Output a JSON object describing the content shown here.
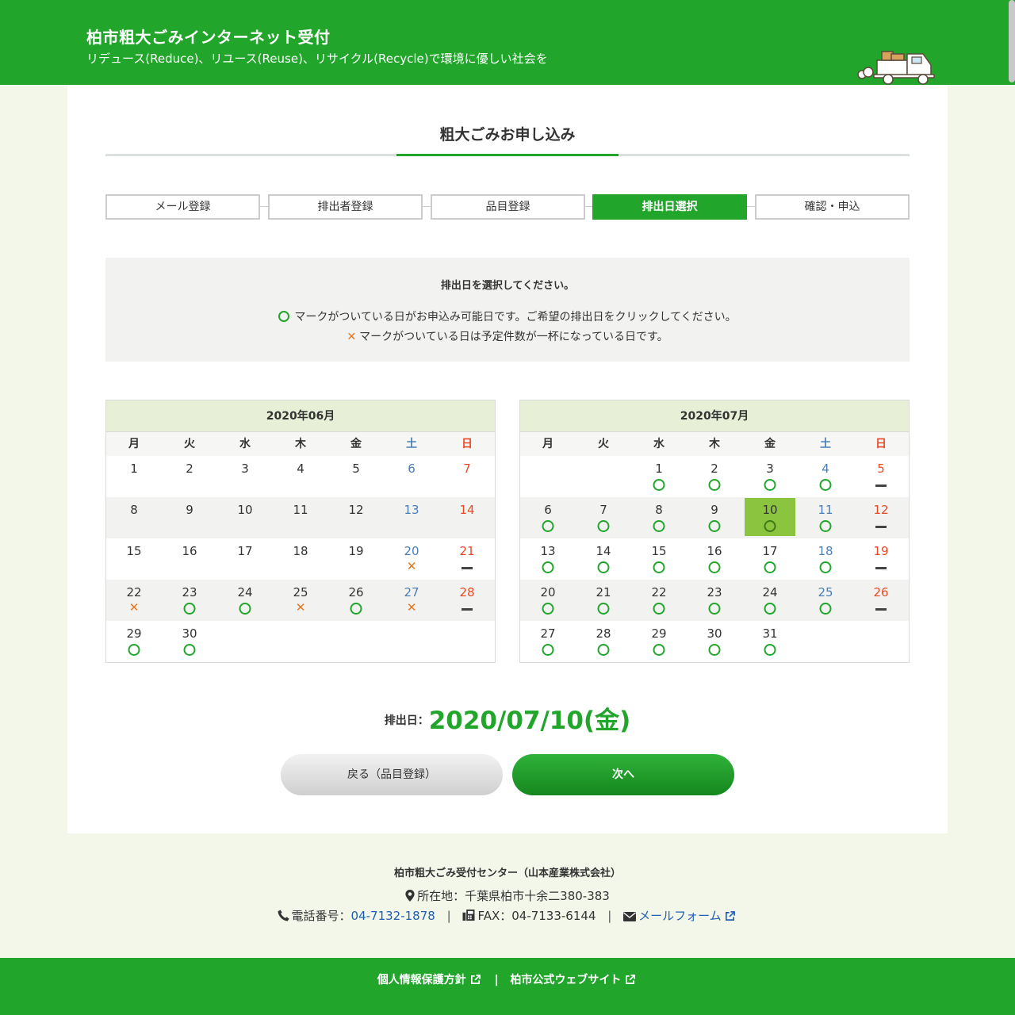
{
  "header": {
    "site_title": "柏市粗大ごみインターネット受付",
    "tagline": "リデュース(Reduce)、リユース(Reuse)、リサイクル(Recycle)で環境に優しい社会を"
  },
  "page_title": "粗大ごみお申し込み",
  "steps": [
    {
      "label": "メール登録",
      "active": false
    },
    {
      "label": "排出者登録",
      "active": false
    },
    {
      "label": "品目登録",
      "active": false
    },
    {
      "label": "排出日選択",
      "active": true
    },
    {
      "label": "確認・申込",
      "active": false
    }
  ],
  "notice": {
    "title": "排出日を選択してください。",
    "line_ok": "マークがついている日がお申込み可能日です。ご希望の排出日をクリックしてください。",
    "line_full": "マークがついている日は予定件数が一杯になっている日です。",
    "x_symbol": "✕"
  },
  "weekdays": [
    "月",
    "火",
    "水",
    "木",
    "金",
    "土",
    "日"
  ],
  "calendars": [
    {
      "title": "2020年06月",
      "weeks": [
        [
          {
            "d": "1"
          },
          {
            "d": "2"
          },
          {
            "d": "3"
          },
          {
            "d": "4"
          },
          {
            "d": "5"
          },
          {
            "d": "6"
          },
          {
            "d": "7"
          }
        ],
        [
          {
            "d": "8"
          },
          {
            "d": "9"
          },
          {
            "d": "10"
          },
          {
            "d": "11"
          },
          {
            "d": "12"
          },
          {
            "d": "13"
          },
          {
            "d": "14"
          }
        ],
        [
          {
            "d": "15"
          },
          {
            "d": "16"
          },
          {
            "d": "17"
          },
          {
            "d": "18"
          },
          {
            "d": "19"
          },
          {
            "d": "20",
            "m": "full"
          },
          {
            "d": "21",
            "m": "closed"
          }
        ],
        [
          {
            "d": "22",
            "m": "full"
          },
          {
            "d": "23",
            "m": "ok"
          },
          {
            "d": "24",
            "m": "ok"
          },
          {
            "d": "25",
            "m": "full"
          },
          {
            "d": "26",
            "m": "ok"
          },
          {
            "d": "27",
            "m": "full"
          },
          {
            "d": "28",
            "m": "closed"
          }
        ],
        [
          {
            "d": "29",
            "m": "ok"
          },
          {
            "d": "30",
            "m": "ok"
          },
          {
            "d": ""
          },
          {
            "d": ""
          },
          {
            "d": ""
          },
          {
            "d": ""
          },
          {
            "d": ""
          }
        ]
      ]
    },
    {
      "title": "2020年07月",
      "weeks": [
        [
          {
            "d": ""
          },
          {
            "d": ""
          },
          {
            "d": "1",
            "m": "ok"
          },
          {
            "d": "2",
            "m": "ok"
          },
          {
            "d": "3",
            "m": "ok"
          },
          {
            "d": "4",
            "m": "ok"
          },
          {
            "d": "5",
            "m": "closed"
          }
        ],
        [
          {
            "d": "6",
            "m": "ok"
          },
          {
            "d": "7",
            "m": "ok"
          },
          {
            "d": "8",
            "m": "ok"
          },
          {
            "d": "9",
            "m": "ok"
          },
          {
            "d": "10",
            "m": "ok",
            "sel": true
          },
          {
            "d": "11",
            "m": "ok"
          },
          {
            "d": "12",
            "m": "closed"
          }
        ],
        [
          {
            "d": "13",
            "m": "ok"
          },
          {
            "d": "14",
            "m": "ok"
          },
          {
            "d": "15",
            "m": "ok"
          },
          {
            "d": "16",
            "m": "ok"
          },
          {
            "d": "17",
            "m": "ok"
          },
          {
            "d": "18",
            "m": "ok"
          },
          {
            "d": "19",
            "m": "closed"
          }
        ],
        [
          {
            "d": "20",
            "m": "ok"
          },
          {
            "d": "21",
            "m": "ok"
          },
          {
            "d": "22",
            "m": "ok"
          },
          {
            "d": "23",
            "m": "ok"
          },
          {
            "d": "24",
            "m": "ok"
          },
          {
            "d": "25",
            "m": "ok"
          },
          {
            "d": "26",
            "m": "closed"
          }
        ],
        [
          {
            "d": "27",
            "m": "ok"
          },
          {
            "d": "28",
            "m": "ok"
          },
          {
            "d": "29",
            "m": "ok"
          },
          {
            "d": "30",
            "m": "ok"
          },
          {
            "d": "31",
            "m": "ok"
          },
          {
            "d": ""
          },
          {
            "d": ""
          }
        ]
      ]
    }
  ],
  "selected_date": {
    "label": "排出日：",
    "value": "2020/07/10(金)"
  },
  "buttons": {
    "back_label": "戻る（品目登録）",
    "next_label": "次へ"
  },
  "footer": {
    "org": "柏市粗大ごみ受付センター（山本産業株式会社）",
    "address": "所在地：千葉県柏市十余二380-383",
    "phone_label": "電話番号：",
    "phone": "04-7132-1878",
    "fax": "FAX：04-7133-6144",
    "mail_label": "メールフォーム",
    "separator": "|",
    "privacy_label": "個人情報保護方針",
    "city_site_label": "柏市公式ウェブサイト"
  },
  "colors": {
    "brand_green": "#21a62b",
    "selected_day": "#8bc53f",
    "saturday": "#4a7fb5",
    "sunday": "#e84a25",
    "full_mark": "#e8761f"
  }
}
